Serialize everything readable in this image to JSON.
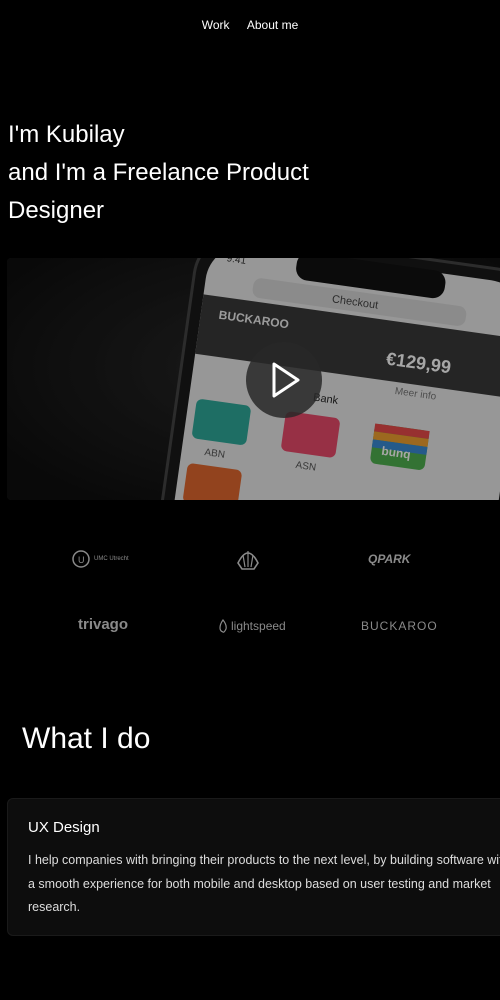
{
  "nav": {
    "work": "Work",
    "about": "About me"
  },
  "hero": {
    "line1": "I'm Kubilay",
    "line2": "and I'm a Freelance Product",
    "line3": "Designer"
  },
  "video": {
    "phone": {
      "time": "9:41",
      "tab": "Checkout",
      "brand": "BUCKAROO",
      "amount": "€129,99",
      "more_info": "Meer info",
      "section": "Bank",
      "bank1": "ABN",
      "bank2": "ASN",
      "bank3": "bunq"
    }
  },
  "logos": {
    "row1": [
      "UMC Utrecht",
      "",
      "QPARK"
    ],
    "row2": [
      "trivago",
      "lightspeed",
      "BUCKAROO"
    ]
  },
  "what": {
    "title": "What I do"
  },
  "card": {
    "title": "UX Design",
    "text_line1": "I help companies with bringing their products to the next level, by building software with",
    "text_line2": "a smooth experience for both mobile and desktop based on user testing and market",
    "text_line3": "research."
  }
}
